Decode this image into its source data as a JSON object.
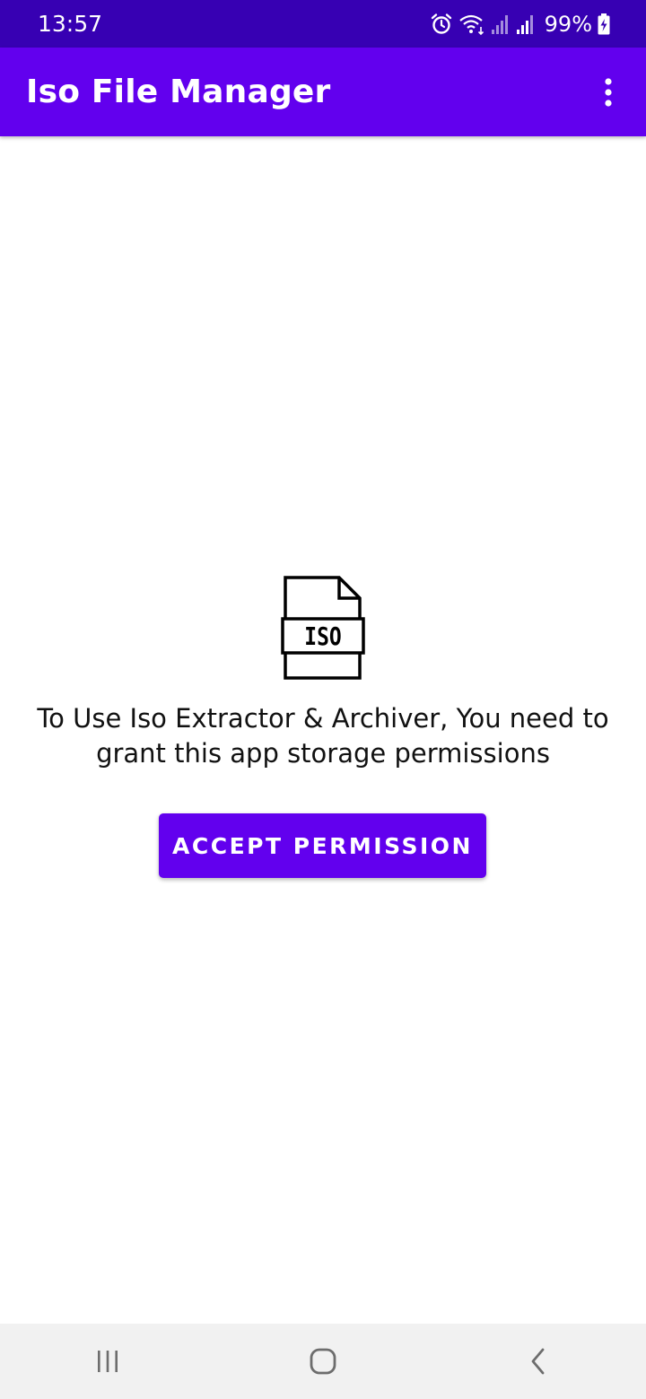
{
  "status_bar": {
    "time": "13:57",
    "battery": "99%",
    "icons": [
      "alarm-icon",
      "wifi-icon",
      "signal-icon",
      "signal-icon",
      "battery-charging-icon"
    ]
  },
  "app_bar": {
    "title": "Iso File Manager",
    "overflow_icon": "more-vert-icon"
  },
  "content": {
    "icon": "iso-file-icon",
    "icon_label": "ISO",
    "message": "To Use Iso Extractor & Archiver, You need to grant this app storage permissions",
    "button_label": "ACCEPT PERMISSION"
  },
  "nav_bar": {
    "buttons": [
      "recent-apps-icon",
      "home-icon",
      "back-icon"
    ]
  },
  "colors": {
    "status_bar": "#3700b3",
    "primary": "#6200ee",
    "nav_bar": "#f1f1f1"
  }
}
